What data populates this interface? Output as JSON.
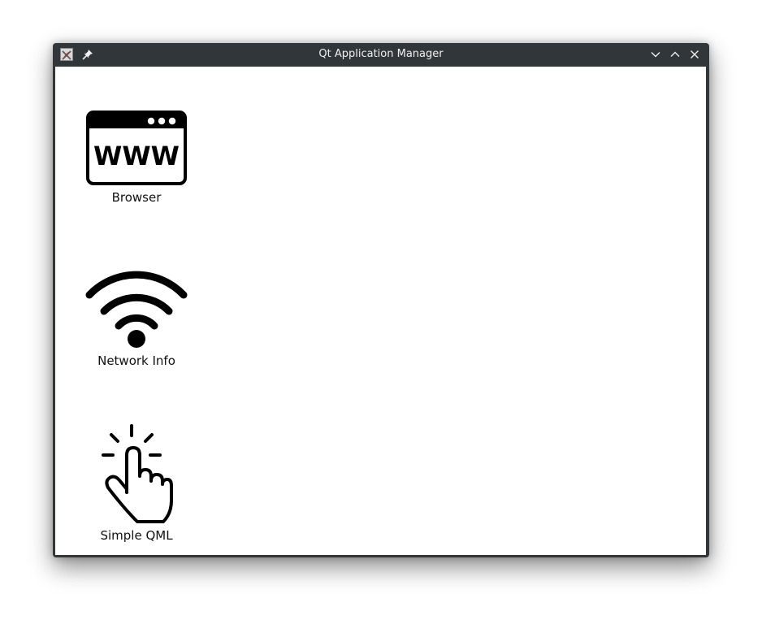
{
  "window": {
    "title": "Qt Application Manager",
    "controls": {
      "minimize_icon": "chevron-down-icon",
      "maximize_icon": "chevron-up-icon",
      "close_icon": "close-icon",
      "pin_icon": "pin-icon"
    }
  },
  "apps": [
    {
      "label": "Browser",
      "icon": "www-browser-icon"
    },
    {
      "label": "Network Info",
      "icon": "wifi-icon"
    },
    {
      "label": "Simple QML",
      "icon": "tap-hand-icon"
    }
  ],
  "colors": {
    "titlebar": "#31363b",
    "title_text": "#eff0f1",
    "client_bg": "#ffffff",
    "icon": "#000000"
  }
}
